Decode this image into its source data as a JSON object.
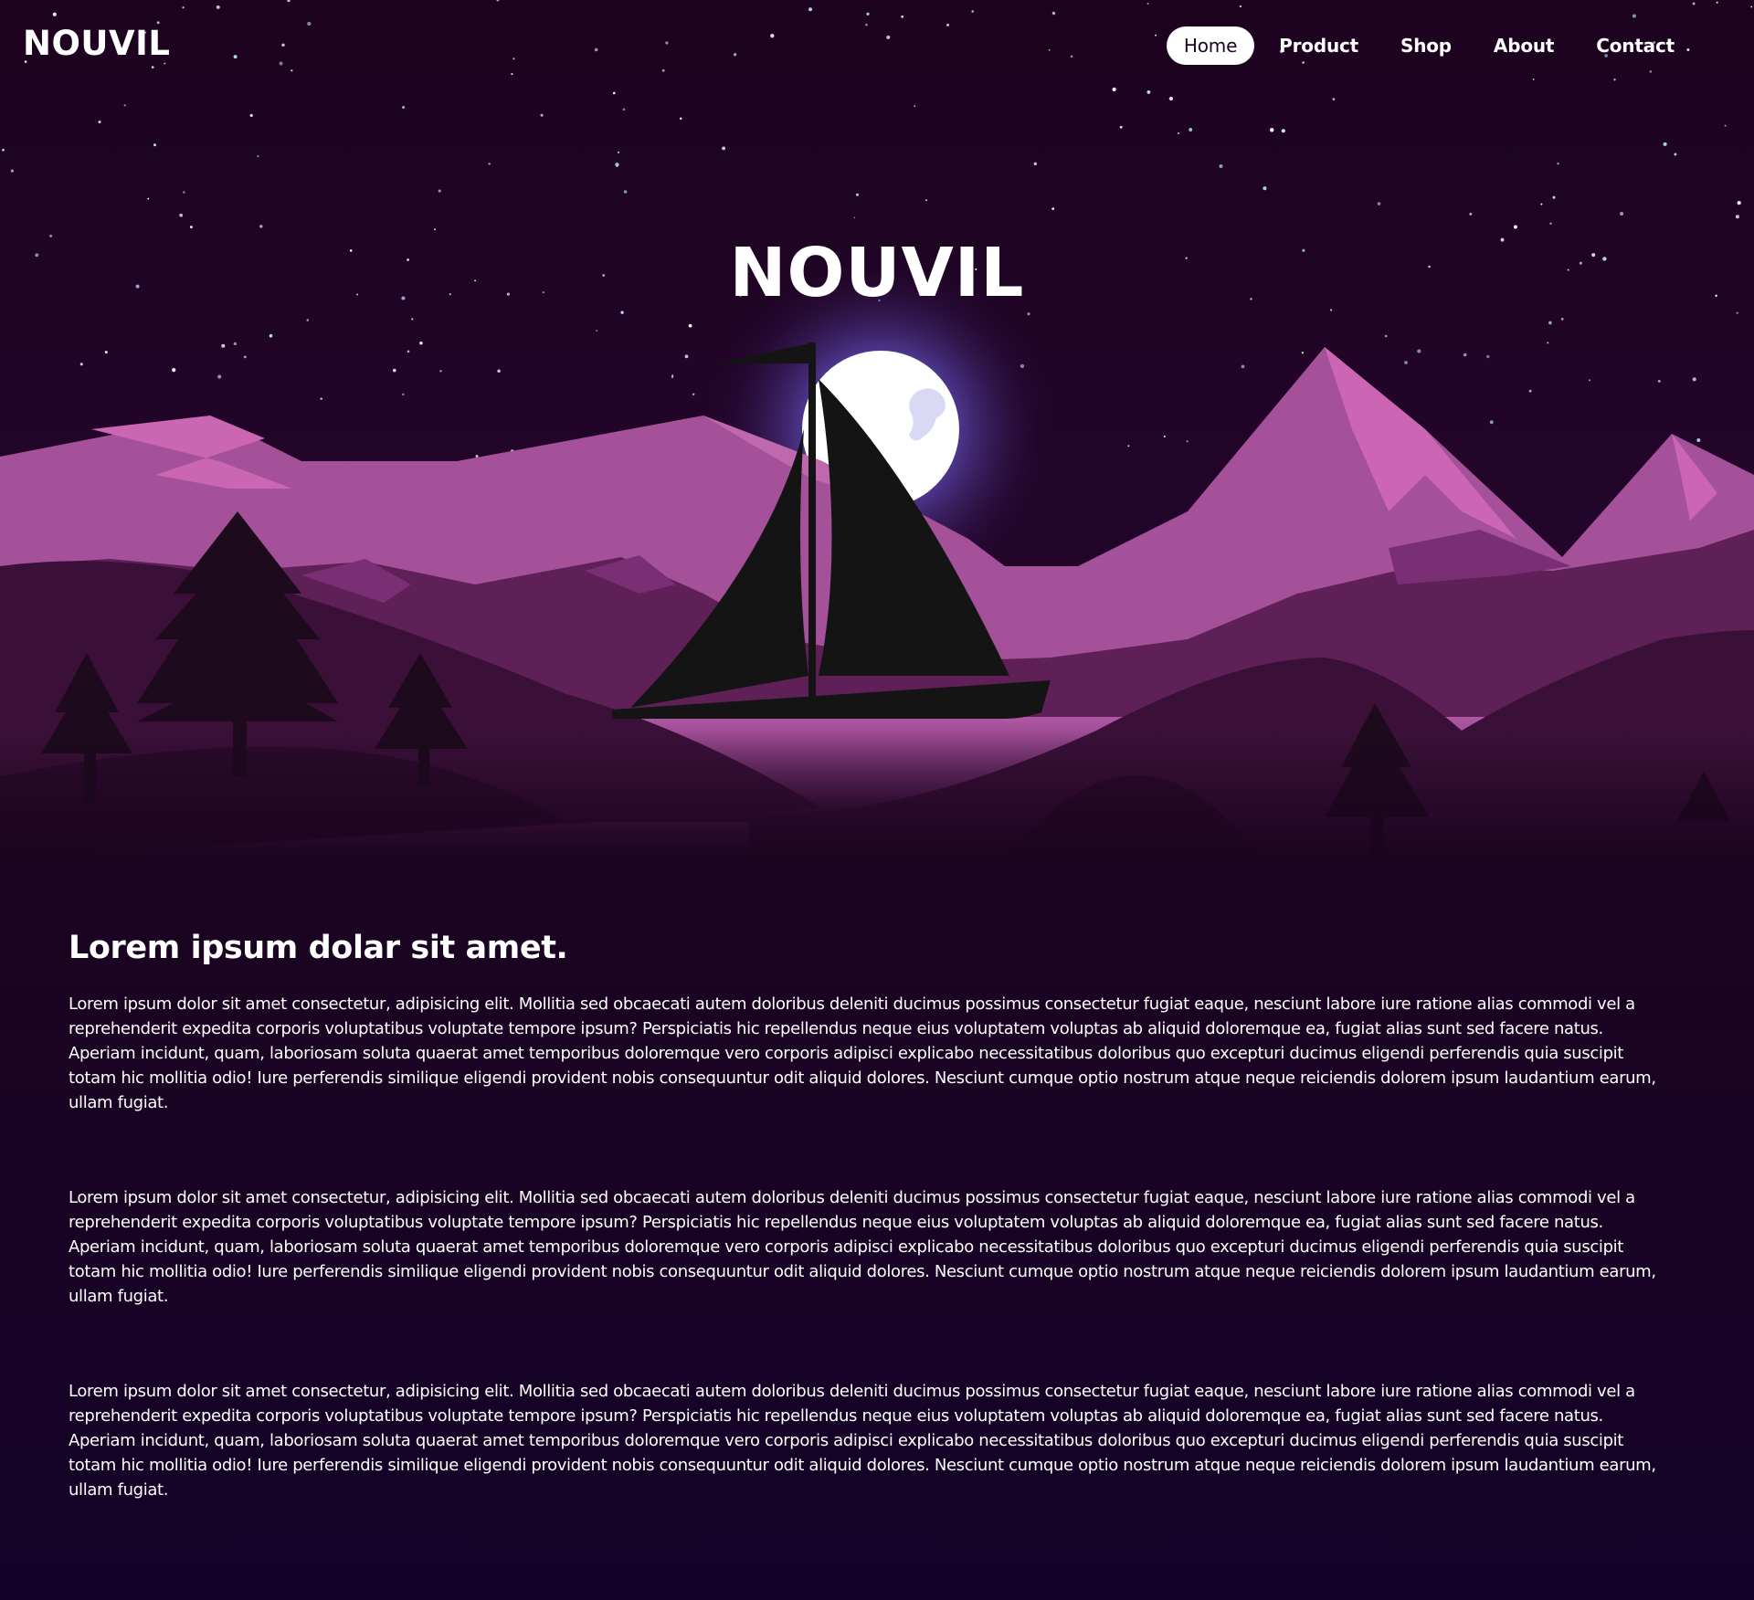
{
  "nav": {
    "logo": "NOUVIL",
    "links": [
      {
        "label": "Home",
        "active": true
      },
      {
        "label": "Product",
        "active": false
      },
      {
        "label": "Shop",
        "active": false
      },
      {
        "label": "About",
        "active": false
      },
      {
        "label": "Contact",
        "active": false
      }
    ]
  },
  "hero": {
    "title": "NOUVIL"
  },
  "content": {
    "heading": "Lorem ipsum dolar sit amet.",
    "paragraphs": [
      "Lorem ipsum dolor sit amet consectetur, adipisicing elit. Mollitia sed obcaecati autem doloribus deleniti ducimus possimus consectetur fugiat eaque, nesciunt labore iure ratione alias commodi vel a reprehenderit expedita corporis voluptatibus voluptate tempore ipsum? Perspiciatis hic repellendus neque eius voluptatem voluptas ab aliquid doloremque ea, fugiat alias sunt sed facere natus. Aperiam incidunt, quam, laboriosam soluta quaerat amet temporibus doloremque vero corporis adipisci explicabo necessitatibus doloribus quo excepturi ducimus eligendi perferendis quia suscipit totam hic mollitia odio! Iure perferendis similique eligendi provident nobis consequuntur odit aliquid dolores. Nesciunt cumque optio nostrum atque neque reiciendis dolorem ipsum laudantium earum, ullam fugiat.",
      "Lorem ipsum dolor sit amet consectetur, adipisicing elit. Mollitia sed obcaecati autem doloribus deleniti ducimus possimus consectetur fugiat eaque, nesciunt labore iure ratione alias commodi vel a reprehenderit expedita corporis voluptatibus voluptate tempore ipsum? Perspiciatis hic repellendus neque eius voluptatem voluptas ab aliquid doloremque ea, fugiat alias sunt sed facere natus. Aperiam incidunt, quam, laboriosam soluta quaerat amet temporibus doloremque vero corporis adipisci explicabo necessitatibus doloribus quo excepturi ducimus eligendi perferendis quia suscipit totam hic mollitia odio! Iure perferendis similique eligendi provident nobis consequuntur odit aliquid dolores. Nesciunt cumque optio nostrum atque neque reiciendis dolorem ipsum laudantium earum, ullam fugiat.",
      "Lorem ipsum dolor sit amet consectetur, adipisicing elit. Mollitia sed obcaecati autem doloribus deleniti ducimus possimus consectetur fugiat eaque, nesciunt labore iure ratione alias commodi vel a reprehenderit expedita corporis voluptatibus voluptate tempore ipsum? Perspiciatis hic repellendus neque eius voluptatem voluptas ab aliquid doloremque ea, fugiat alias sunt sed facere natus. Aperiam incidunt, quam, laboriosam soluta quaerat amet temporibus doloremque vero corporis adipisci explicabo necessitatibus doloribus quo excepturi ducimus eligendi perferendis quia suscipit totam hic mollitia odio! Iure perferendis similique eligendi provident nobis consequuntur odit aliquid dolores. Nesciunt cumque optio nostrum atque neque reiciendis dolorem ipsum laudantium earum, ullam fugiat."
    ]
  },
  "colors": {
    "background": "#1c0420",
    "nav_active_bg": "#ffffff",
    "mountain_light": "#a45199",
    "mountain_highlight": "#cb66b2",
    "mountain_mid": "#5e2057",
    "hills_dark": "#3a1038",
    "moon": "#ffffff",
    "moon_glow": "#7b6ee8",
    "boat": "#141414"
  }
}
